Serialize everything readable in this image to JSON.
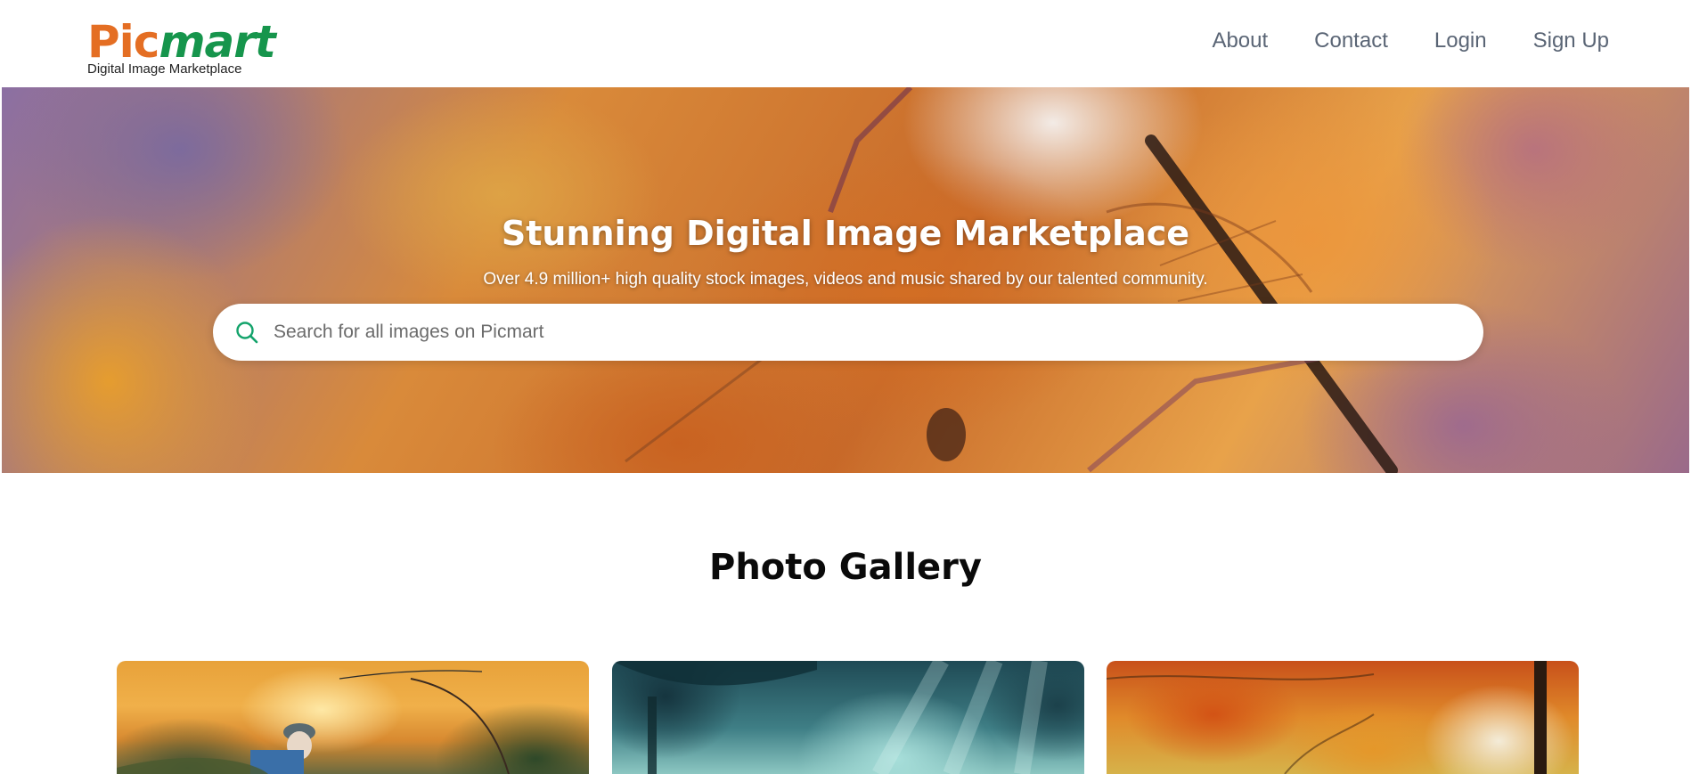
{
  "header": {
    "logo_pic": "Pic",
    "logo_mart": "mart",
    "logo_tagline": "Digital Image Marketplace",
    "nav": [
      {
        "label": "About"
      },
      {
        "label": "Contact"
      },
      {
        "label": "Login"
      },
      {
        "label": "Sign Up"
      }
    ]
  },
  "hero": {
    "title": "Stunning Digital Image Marketplace",
    "subtitle": "Over 4.9 million+ high quality stock images, videos and music shared by our talented community.",
    "search_placeholder": "Search for all images on Picmart"
  },
  "gallery": {
    "title": "Photo Gallery"
  },
  "colors": {
    "brand_orange": "#e46e23",
    "brand_green": "#16954c",
    "search_icon": "#13a36b",
    "nav_text": "#5a6575"
  }
}
